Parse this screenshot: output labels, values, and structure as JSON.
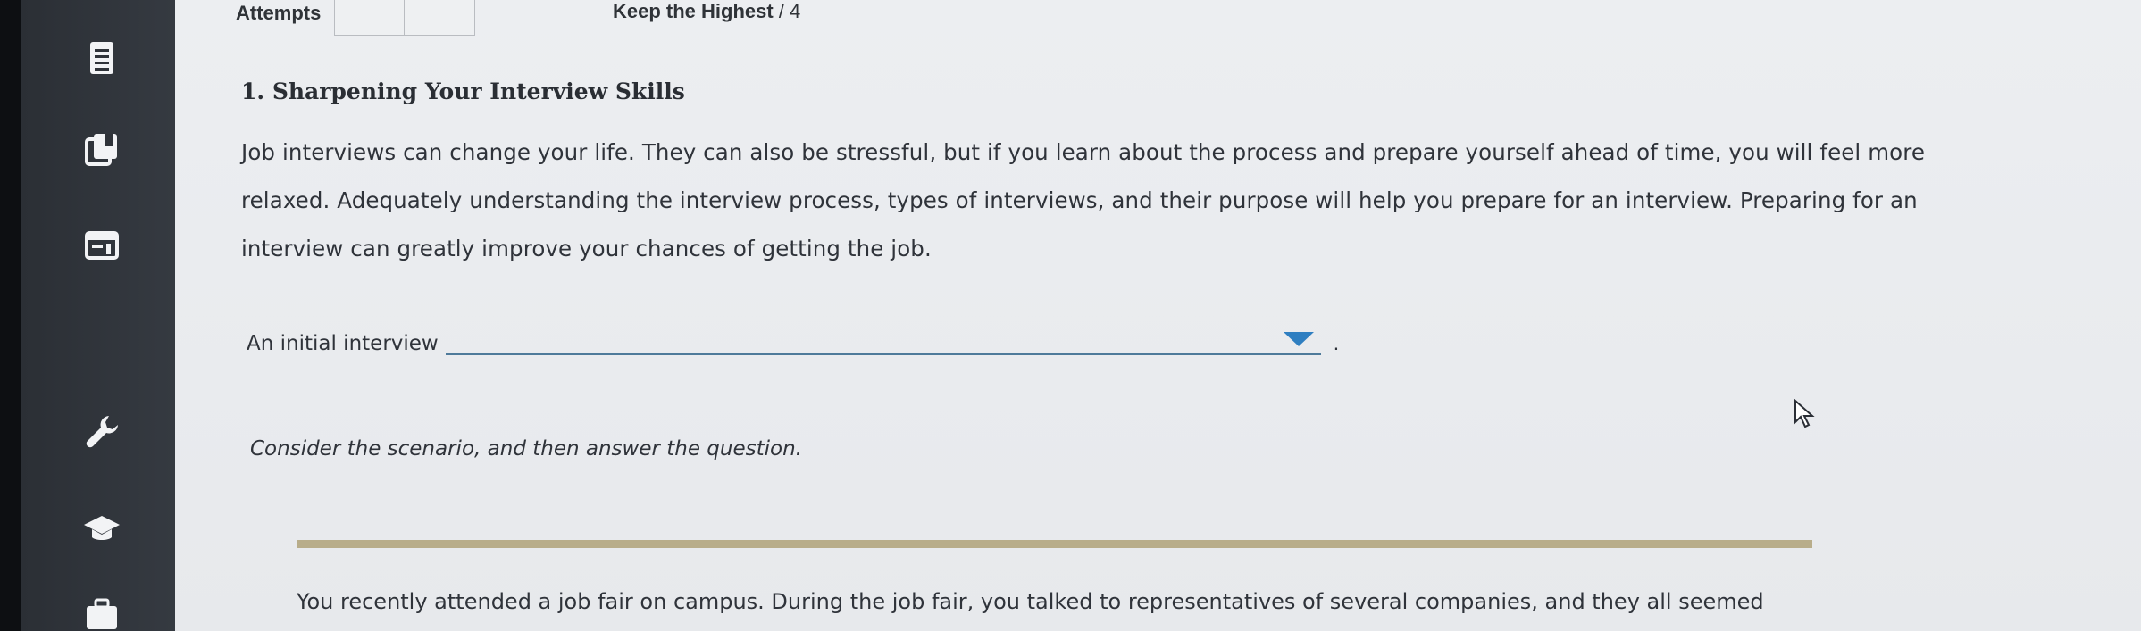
{
  "header": {
    "attempts_label": "Attempts",
    "keep_highest_label": "Keep the Highest",
    "keep_highest_value": "/ 4"
  },
  "sidebar": {
    "items": [
      {
        "icon": "assignment-list-icon"
      },
      {
        "icon": "ebook-icon"
      },
      {
        "icon": "gradebook-icon"
      },
      {
        "icon": "wrench-icon"
      },
      {
        "icon": "graduation-cap-icon"
      },
      {
        "icon": "briefcase-icon"
      }
    ]
  },
  "question": {
    "number": "1.",
    "title": "Sharpening Your Interview Skills",
    "paragraph": "Job interviews can change your life. They can also be stressful, but if you learn about the process and prepare yourself ahead of time, you will feel more relaxed. Adequately understanding the interview process, types of interviews, and their purpose will help you prepare for an interview. Preparing for an interview can greatly improve your chances of getting the job.",
    "fill_label": "An initial interview",
    "fill_value": "",
    "fill_end": ".",
    "scenario_prompt": "Consider the scenario, and then answer the question.",
    "scenario_text": "You recently attended a job fair on campus. During the job fair, you talked to representatives of several companies, and they all seemed"
  },
  "colors": {
    "sidebar_bg": "#2f3339",
    "dropdown_accent": "#2f7fc1",
    "divider": "#b8ad8a"
  }
}
